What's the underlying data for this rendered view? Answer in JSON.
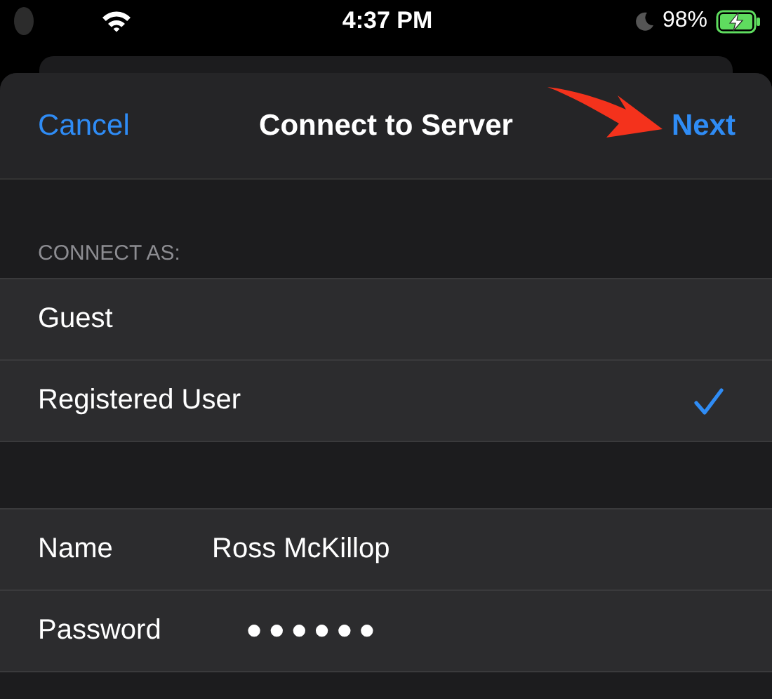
{
  "status_bar": {
    "time": "4:37 PM",
    "battery": "98%",
    "charging": true
  },
  "nav": {
    "cancel": "Cancel",
    "title": "Connect to Server",
    "next": "Next"
  },
  "section": {
    "header": "CONNECT AS:",
    "options": [
      {
        "label": "Guest",
        "selected": false
      },
      {
        "label": "Registered User",
        "selected": true
      }
    ]
  },
  "fields": [
    {
      "label": "Name",
      "value": "Ross McKillop",
      "kind": "text"
    },
    {
      "label": "Password",
      "value": "●●●●●●",
      "kind": "password"
    }
  ]
}
